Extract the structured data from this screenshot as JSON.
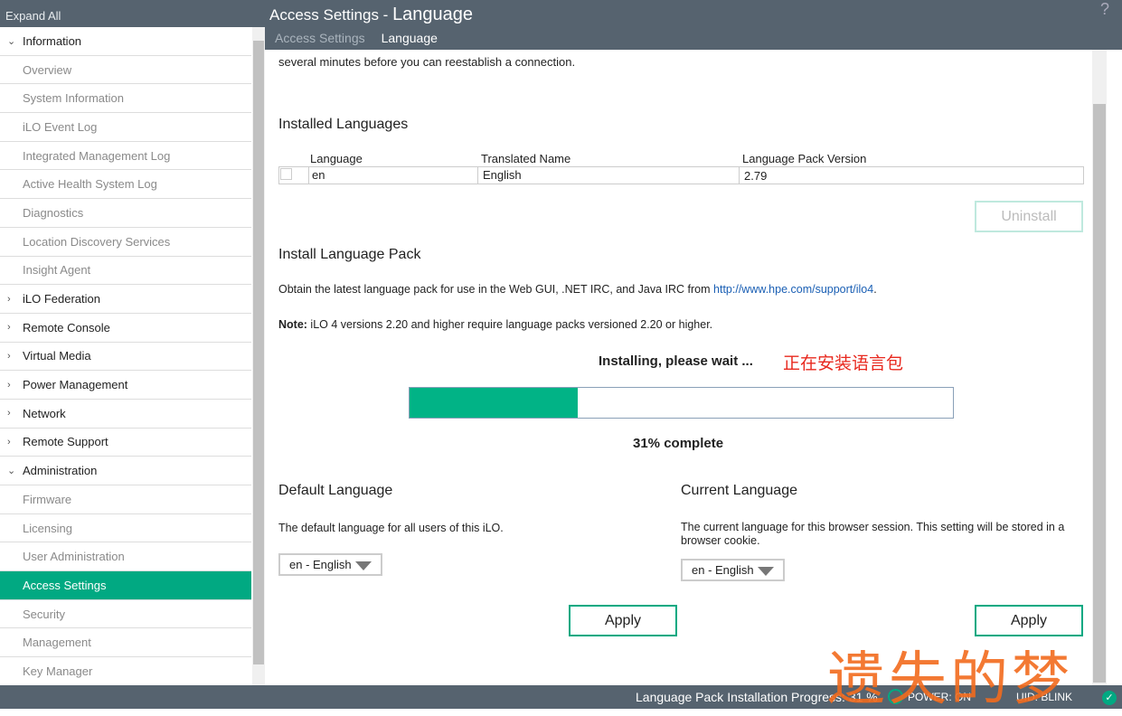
{
  "sidebar": {
    "expand_all": "Expand All",
    "items": [
      {
        "label": "Information",
        "type": "group",
        "open": true
      },
      {
        "label": "Overview"
      },
      {
        "label": "System Information"
      },
      {
        "label": "iLO Event Log"
      },
      {
        "label": "Integrated Management Log"
      },
      {
        "label": "Active Health System Log"
      },
      {
        "label": "Diagnostics"
      },
      {
        "label": "Location Discovery Services"
      },
      {
        "label": "Insight Agent"
      },
      {
        "label": "iLO Federation",
        "type": "group"
      },
      {
        "label": "Remote Console",
        "type": "group"
      },
      {
        "label": "Virtual Media",
        "type": "group"
      },
      {
        "label": "Power Management",
        "type": "group"
      },
      {
        "label": "Network",
        "type": "group"
      },
      {
        "label": "Remote Support",
        "type": "group"
      },
      {
        "label": "Administration",
        "type": "group",
        "open": true
      },
      {
        "label": "Firmware"
      },
      {
        "label": "Licensing"
      },
      {
        "label": "User Administration"
      },
      {
        "label": "Access Settings",
        "active": true
      },
      {
        "label": "Security"
      },
      {
        "label": "Management"
      },
      {
        "label": "Key Manager"
      }
    ]
  },
  "header": {
    "title_prefix": "Access Settings - ",
    "title_main": "Language",
    "help": "?",
    "tabs": [
      {
        "label": "Access Settings"
      },
      {
        "label": "Language",
        "active": true
      }
    ]
  },
  "main": {
    "notice": "several minutes before you can reestablish a connection.",
    "installed_title": "Installed Languages",
    "table": {
      "headers": [
        "Language",
        "Translated Name",
        "Language Pack Version"
      ],
      "rows": [
        [
          "en",
          "English",
          "2.79"
        ]
      ]
    },
    "uninstall": "Uninstall",
    "install_title": "Install Language Pack",
    "obtain_text": "Obtain the latest language pack for use in the Web GUI, .NET IRC, and Java IRC from ",
    "obtain_link": "http://www.hpe.com/support/ilo4",
    "obtain_end": ".",
    "note_label": "Note:",
    "note_text": " iLO 4 versions 2.20 and higher require language packs versioned 2.20 or higher.",
    "installing": "Installing, please wait ...",
    "annotation": "正在安装语言包",
    "progress_percent": 31,
    "progress_text": "31% complete",
    "default_title": "Default Language",
    "default_desc": "The default language for all users of this iLO.",
    "default_value": "en - English",
    "current_title": "Current Language",
    "current_desc": "The current language for this browser session. This setting will be stored in a browser cookie.",
    "current_value": "en - English",
    "apply": "Apply"
  },
  "status": {
    "progress": "Language Pack Installation Progress: 31 %",
    "power": "POWER: ON",
    "uid": "UID: BLINK"
  },
  "watermark": "遗失的梦",
  "colors": {
    "accent": "#01a982",
    "header": "#56636f",
    "annotation": "#e8281e"
  }
}
